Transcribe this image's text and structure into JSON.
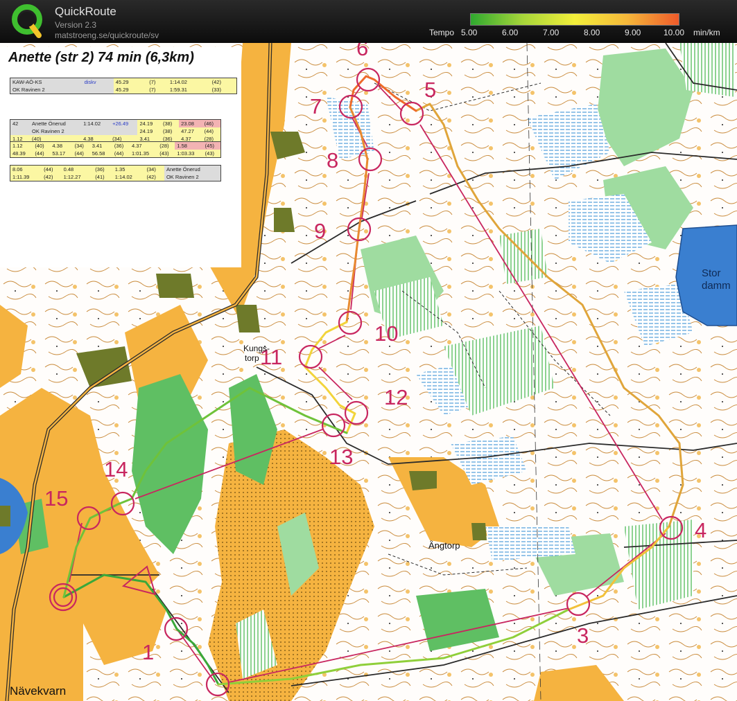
{
  "app": {
    "name": "QuickRoute",
    "version": "Version 2.3",
    "url": "matstroeng.se/quickroute/sv"
  },
  "tempo_scale": {
    "label": "Tempo",
    "ticks": [
      "5.00",
      "6.00",
      "7.00",
      "8.00",
      "9.00",
      "10.00"
    ],
    "unit": "min/km",
    "colors": [
      "#2fa82f",
      "#a7d63a",
      "#f2ee3a",
      "#f5b83a",
      "#ee5a2a"
    ]
  },
  "panel": {
    "title": "Anette (str 2) 74 min (6,3km)",
    "result_rows": [
      [
        "KAW-AÖ-KS",
        "diskv",
        "45.29",
        "(7)",
        "1:14.02",
        "(42)"
      ],
      [
        "OK Ravinen 2",
        "",
        "45.29",
        "(7)",
        "1:59.31",
        "(33)"
      ]
    ],
    "runner": {
      "place": "42",
      "name": "Anette Önerud",
      "club": "OK Ravinen 2",
      "time": "1:14.02",
      "diff": "+26.49",
      "leg1_split": "24.19",
      "leg1_split_rank": "(38)",
      "leg1_cum": "24.19",
      "leg1_cum_rank": "(38)",
      "leg2_split": "23.08",
      "leg2_split_rank": "(46)",
      "leg2_cum": "47.27",
      "leg2_cum_rank": "(44)"
    },
    "splits_row1": [
      [
        "1.12",
        "(40)",
        "4.38",
        "(34)",
        "3.41",
        "(36)",
        "4.37",
        "(28)",
        "1.58",
        "(45)"
      ],
      [
        "48.39",
        "(44)",
        "53.17",
        "(44)",
        "56.58",
        "(44)",
        "1:01.35",
        "(43)",
        "1:03.33",
        "(43)"
      ]
    ],
    "splits_row2": [
      [
        "8.06",
        "(44)",
        "0.48",
        "(36)",
        "1.35",
        "(34)",
        "Anette Önerud"
      ],
      [
        "1:11.39",
        "(42)",
        "1:12.27",
        "(41)",
        "1:14.02",
        "(42)",
        "OK Ravinen 2"
      ]
    ]
  },
  "map": {
    "control_numbers": [
      "1",
      "3",
      "4",
      "5",
      "6",
      "7",
      "8",
      "9",
      "10",
      "11",
      "12",
      "13",
      "14",
      "15"
    ],
    "place_names": [
      "Kungs-",
      "torp",
      "Ängtorp",
      "Nävekvarn",
      "Stor",
      "damm"
    ]
  }
}
